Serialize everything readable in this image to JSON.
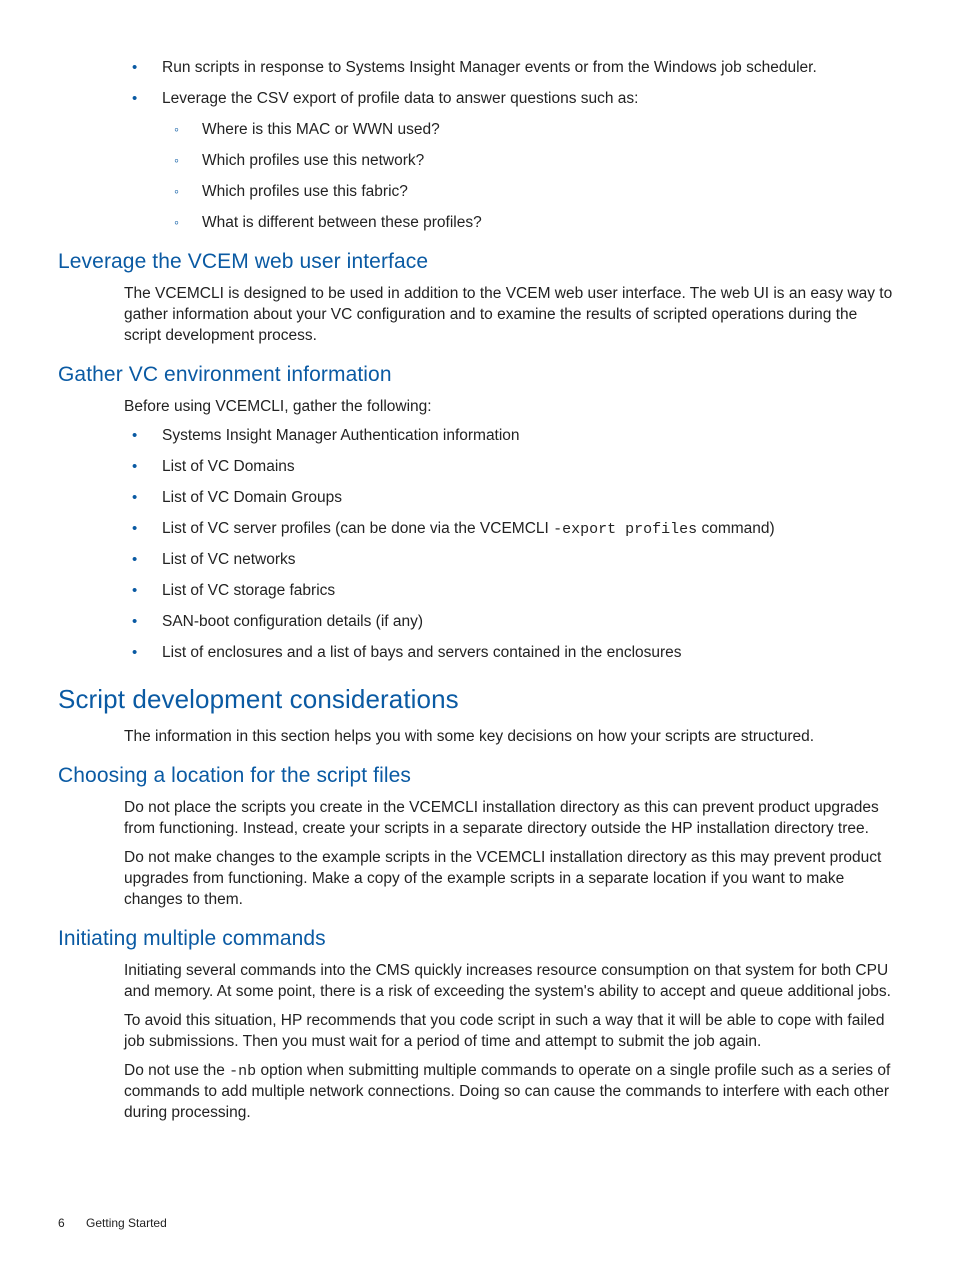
{
  "top_bullets": [
    "Run scripts in response to Systems Insight Manager events or from the Windows job scheduler.",
    "Leverage the CSV export of profile data to answer questions such as:"
  ],
  "top_sub_bullets": [
    "Where is this MAC or WWN used?",
    "Which profiles use this network?",
    "Which profiles use this fabric?",
    "What is different between these profiles?"
  ],
  "sections": {
    "leverage": {
      "title": "Leverage the VCEM web user interface",
      "para": "The VCEMCLI is designed to be used in addition to the VCEM web user interface. The web UI is an easy way to gather information about your VC configuration and to examine the results of scripted operations during the script development process."
    },
    "gather": {
      "title": "Gather VC environment information",
      "intro": "Before using VCEMCLI, gather the following:",
      "items_pre": [
        "Systems Insight Manager Authentication information",
        "List of VC Domains",
        "List of VC Domain Groups"
      ],
      "item_code_prefix": "List of VC server profiles (can be done via the VCEMCLI ",
      "item_code": "-export profiles",
      "item_code_suffix": " command)",
      "items_post": [
        "List of VC networks",
        "List of VC storage fabrics",
        "SAN-boot configuration details (if any)",
        "List of enclosures and a list of bays and servers contained in the enclosures"
      ]
    },
    "script": {
      "title": "Script development considerations",
      "para": "The information in this section helps you with some key decisions on how your scripts are structured."
    },
    "choosing": {
      "title": "Choosing a location for the script files",
      "p1": "Do not place the scripts you create in the VCEMCLI installation directory as this can prevent product upgrades from functioning. Instead, create your scripts in a separate directory outside the HP installation directory tree.",
      "p2": "Do not make changes to the example scripts in the VCEMCLI installation directory as this may prevent product upgrades from functioning. Make a copy of the example scripts in a separate location if you want to make changes to them."
    },
    "initiating": {
      "title": "Initiating multiple commands",
      "p1": "Initiating several commands into the CMS quickly increases resource consumption on that system for both CPU and memory. At some point, there is a risk of exceeding the system's ability to accept and queue additional jobs.",
      "p2": "To avoid this situation, HP recommends that you code script in such a way that it will be able to cope with failed job submissions. Then you must wait for a period of time and attempt to submit the job again.",
      "p3_pre": "Do not use the ",
      "p3_code": "-nb",
      "p3_post": " option when submitting multiple commands to operate on a single profile such as a series of commands to add multiple network connections. Doing so can cause the commands to interfere with each other during processing."
    }
  },
  "footer": {
    "page": "6",
    "section": "Getting Started"
  }
}
